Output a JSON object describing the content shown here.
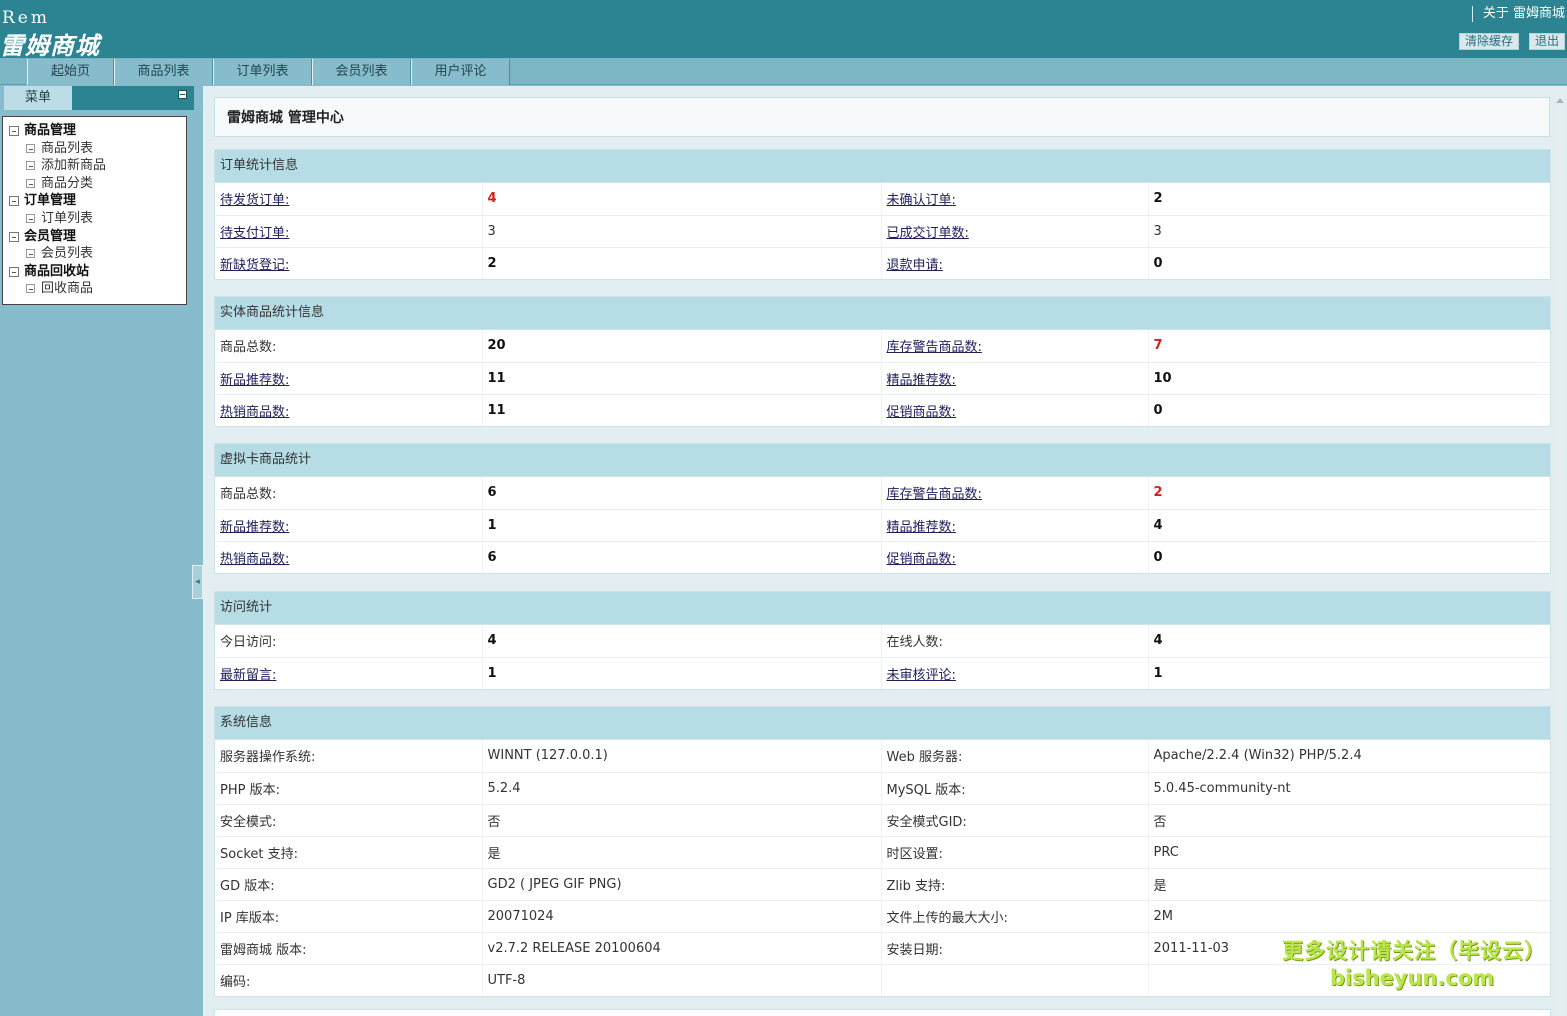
{
  "header": {
    "logo_small": "Rem",
    "logo_title": "雷姆商城",
    "about_link": "关于 雷姆商城",
    "clear_cache_label": "清除缓存",
    "logout_label": "退出"
  },
  "nav": {
    "tabs": [
      "起始页",
      "商品列表",
      "订单列表",
      "会员列表",
      "用户评论"
    ]
  },
  "sidebar": {
    "menu_label": "菜单",
    "tree": [
      {
        "label": "商品管理",
        "type": "category"
      },
      {
        "label": "商品列表",
        "type": "item"
      },
      {
        "label": "添加新商品",
        "type": "item"
      },
      {
        "label": "商品分类",
        "type": "item"
      },
      {
        "label": "订单管理",
        "type": "category"
      },
      {
        "label": "订单列表",
        "type": "item"
      },
      {
        "label": "会员管理",
        "type": "category"
      },
      {
        "label": "会员列表",
        "type": "item"
      },
      {
        "label": "商品回收站",
        "type": "category"
      },
      {
        "label": "回收商品",
        "type": "item"
      }
    ]
  },
  "main": {
    "title": "雷姆商城 管理中心",
    "order_stats": {
      "heading": "订单统计信息",
      "rows": [
        {
          "k1": "待发货订单:",
          "v1": "4",
          "k2": "未确认订单:",
          "v2": "2"
        },
        {
          "k1": "待支付订单:",
          "v1": "3",
          "k2": "已成交订单数:",
          "v2": "3"
        },
        {
          "k1": "新缺货登记:",
          "v1": "2",
          "k2": "退款申请:",
          "v2": "0"
        }
      ]
    },
    "goods_stats": {
      "heading": "实体商品统计信息",
      "rows": [
        {
          "k1": "商品总数:",
          "v1": "20",
          "k2": "库存警告商品数:",
          "v2": "7"
        },
        {
          "k1": "新品推荐数:",
          "v1": "11",
          "k2": "精品推荐数:",
          "v2": "10"
        },
        {
          "k1": "热销商品数:",
          "v1": "11",
          "k2": "促销商品数:",
          "v2": "0"
        }
      ]
    },
    "virtual_stats": {
      "heading": "虚拟卡商品统计",
      "rows": [
        {
          "k1": "商品总数:",
          "v1": "6",
          "k2": "库存警告商品数:",
          "v2": "2"
        },
        {
          "k1": "新品推荐数:",
          "v1": "1",
          "k2": "精品推荐数:",
          "v2": "4"
        },
        {
          "k1": "热销商品数:",
          "v1": "6",
          "k2": "促销商品数:",
          "v2": "0"
        }
      ]
    },
    "visit_stats": {
      "heading": "访问统计",
      "rows": [
        {
          "k1": "今日访问:",
          "v1": "4",
          "k2": "在线人数:",
          "v2": "4"
        },
        {
          "k1": "最新留言:",
          "v1": "1",
          "k2": "未审核评论:",
          "v2": "1"
        }
      ]
    },
    "system_info": {
      "heading": "系统信息",
      "rows": [
        {
          "k1": "服务器操作系统:",
          "v1": "WINNT (127.0.0.1)",
          "k2": "Web 服务器:",
          "v2": "Apache/2.2.4 (Win32) PHP/5.2.4"
        },
        {
          "k1": "PHP 版本:",
          "v1": "5.2.4",
          "k2": "MySQL 版本:",
          "v2": "5.0.45-community-nt"
        },
        {
          "k1": "安全模式:",
          "v1": "否",
          "k2": "安全模式GID:",
          "v2": "否"
        },
        {
          "k1": "Socket 支持:",
          "v1": "是",
          "k2": "时区设置:",
          "v2": "PRC"
        },
        {
          "k1": "GD 版本:",
          "v1": "GD2 ( JPEG GIF PNG)",
          "k2": "Zlib 支持:",
          "v2": "是"
        },
        {
          "k1": "IP 库版本:",
          "v1": "20071024",
          "k2": "文件上传的最大大小:",
          "v2": "2M"
        },
        {
          "k1": "雷姆商城 版本:",
          "v1": "v2.7.2 RELEASE 20100604",
          "k2": "安装日期:",
          "v2": "2011-11-03"
        },
        {
          "k1": "编码:",
          "v1": "UTF-8",
          "k2": "",
          "v2": ""
        }
      ]
    }
  },
  "watermark": {
    "line1": "更多设计请关注（毕设云）",
    "line2": "bisheyun.com"
  },
  "colors": {
    "header_bg": "#2c8493",
    "nav_bg": "#7cb6c5",
    "sidebar_bg": "#86bccb",
    "panel_head_bg": "#b6dce6",
    "alert_red": "#d21f1f"
  }
}
